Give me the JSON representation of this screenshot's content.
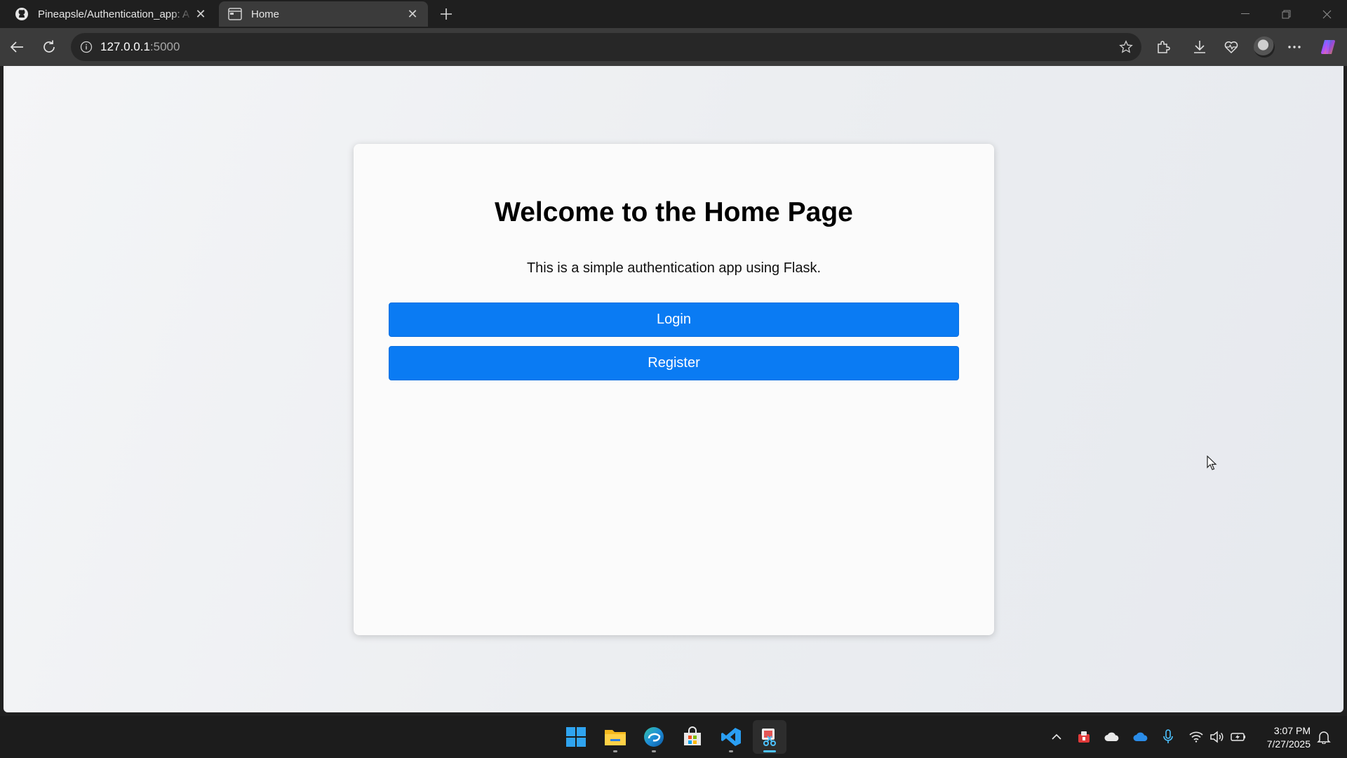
{
  "browser": {
    "tabs": [
      {
        "title": "Pineapsle/Authentication_app: A",
        "icon": "github-icon"
      },
      {
        "title": "Home",
        "icon": "page-icon"
      }
    ],
    "address": {
      "host": "127.0.0.1",
      "port": ":5000"
    }
  },
  "page": {
    "heading": "Welcome to the Home Page",
    "description": "This is a simple authentication app using Flask.",
    "login_label": "Login",
    "register_label": "Register",
    "accent_color": "#0a7bf3"
  },
  "taskbar": {
    "apps": [
      "start-icon",
      "file-explorer-icon",
      "edge-icon",
      "store-icon",
      "vscode-icon",
      "snipping-tool-icon"
    ],
    "time": "3:07 PM",
    "date": "7/27/2025"
  }
}
